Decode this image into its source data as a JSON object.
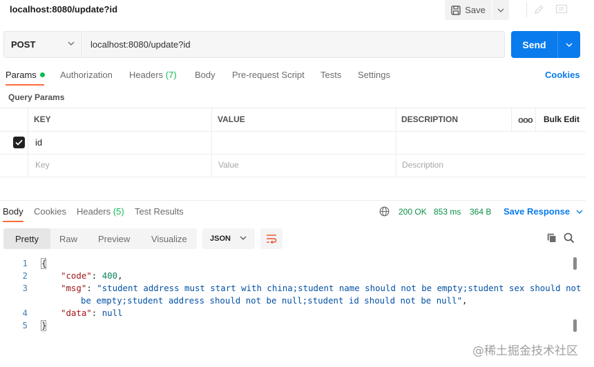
{
  "title": "localhost:8080/update?id",
  "toolbar": {
    "save_label": "Save"
  },
  "request": {
    "method": "POST",
    "url": "localhost:8080/update?id",
    "send_label": "Send"
  },
  "request_tabs": {
    "params": "Params",
    "authorization": "Authorization",
    "headers": "Headers",
    "headers_count": "(7)",
    "body": "Body",
    "prerequest": "Pre-request Script",
    "tests": "Tests",
    "settings": "Settings",
    "cookies": "Cookies"
  },
  "query_params": {
    "title": "Query Params",
    "columns": {
      "key": "KEY",
      "value": "VALUE",
      "description": "DESCRIPTION"
    },
    "ellipsis": "ooo",
    "bulk_edit": "Bulk Edit",
    "rows": [
      {
        "checked": true,
        "key": "id",
        "value": "",
        "description": ""
      }
    ],
    "placeholders": {
      "key": "Key",
      "value": "Value",
      "description": "Description"
    }
  },
  "response_tabs": {
    "body": "Body",
    "cookies": "Cookies",
    "headers": "Headers",
    "headers_count": "(5)",
    "test_results": "Test Results"
  },
  "response_status": {
    "status": "200 OK",
    "time": "853 ms",
    "size": "364 B",
    "save_response": "Save Response"
  },
  "response_view": {
    "modes": [
      "Pretty",
      "Raw",
      "Preview",
      "Visualize"
    ],
    "active_mode": "Pretty",
    "format": "JSON"
  },
  "response_body": {
    "line_numbers": [
      "1",
      "2",
      "3",
      "4",
      "5"
    ],
    "open_brace": "{",
    "close_brace": "}",
    "code_key": "\"code\"",
    "code_value": "400",
    "msg_key": "\"msg\"",
    "msg_value_line1": "\"student address must start with china;student name should not be empty;student sex should not",
    "msg_value_line2": "be empty;student address should not be null;student id should not be null\"",
    "data_key": "\"data\"",
    "data_value": "null"
  },
  "watermark": "@稀土掘金技术社区",
  "colors": {
    "accent_blue": "#097bed",
    "tab_indicator": "#ff6c37",
    "success_green": "#0cbb52"
  }
}
